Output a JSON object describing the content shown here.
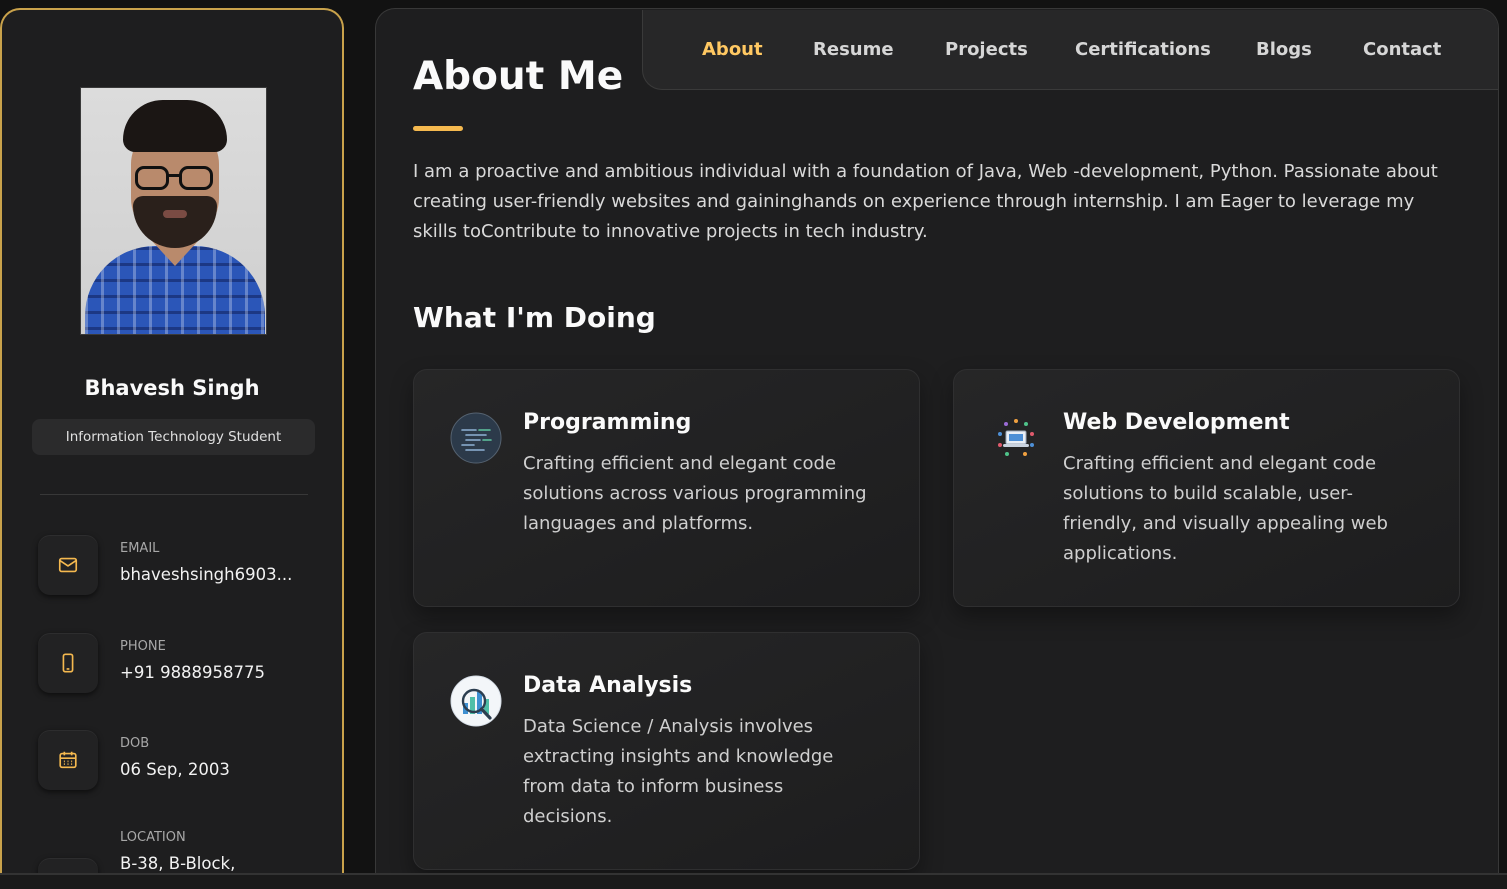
{
  "sidebar": {
    "name": "Bhavesh Singh",
    "title": "Information Technology Student",
    "contacts": [
      {
        "label": "EMAIL",
        "value": "bhaveshsingh6903...",
        "icon": "mail-icon"
      },
      {
        "label": "PHONE",
        "value": "+91 9888958775",
        "icon": "phone-icon"
      },
      {
        "label": "DOB",
        "value": "06 Sep, 2003",
        "icon": "calendar-icon"
      },
      {
        "label": "LOCATION",
        "value": "B-38, B-Block,",
        "icon": "location-icon"
      }
    ]
  },
  "nav": {
    "items": [
      "About",
      "Resume",
      "Projects",
      "Certifications",
      "Blogs",
      "Contact"
    ],
    "active": "About"
  },
  "about": {
    "title": "About Me",
    "text": "I am a proactive and ambitious individual with a foundation of Java, Web -development, Python. Passionate about creating user-friendly websites and gaininghands on experience through internship. I am Eager to leverage my skills toContribute to innovative projects in tech industry."
  },
  "doing": {
    "title": "What I'm Doing",
    "services": [
      {
        "title": "Programming",
        "desc": "Crafting efficient and elegant code solutions across various programming languages and platforms.",
        "icon": "code-screen-icon"
      },
      {
        "title": "Web Development",
        "desc": "Crafting efficient and elegant code solutions to build scalable, user-friendly, and visually appealing web applications.",
        "icon": "web-dev-icon"
      },
      {
        "title": "Data Analysis",
        "desc": "Data Science / Analysis involves extracting insights and knowledge from data to inform business decisions.",
        "icon": "data-chart-icon"
      }
    ]
  },
  "colors": {
    "accent": "#ffc862",
    "accent_bar": "#f5b94f",
    "sidebar_border": "#c9a24b"
  }
}
